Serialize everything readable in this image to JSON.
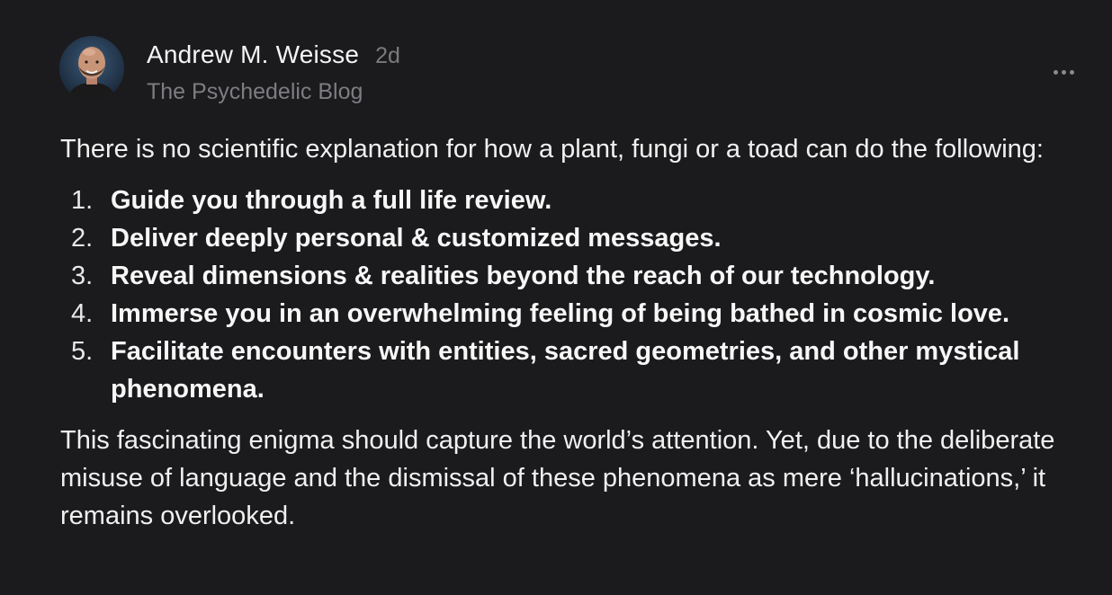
{
  "author": {
    "name": "Andrew M. Weisse",
    "timestamp": "2d",
    "publication": "The Psychedelic Blog"
  },
  "menu": {
    "icon": "more-horizontal-icon"
  },
  "post": {
    "intro": "There is no scientific explanation for how a plant, fungi or a toad can do the following:",
    "list": [
      {
        "num": "1.",
        "text": "Guide you through a full life review."
      },
      {
        "num": "2.",
        "text": "Deliver deeply personal & customized messages."
      },
      {
        "num": "3.",
        "text": "Reveal dimensions & realities beyond the reach of our technology."
      },
      {
        "num": "4.",
        "text": "Immerse you in an overwhelming feeling of being bathed in cosmic love."
      },
      {
        "num": "5.",
        "text": "Facilitate encounters with entities, sacred geometries, and other mystical phenomena."
      }
    ],
    "outro": "This fascinating enigma should capture the world’s attention. Yet, due to the deliberate misuse of language and the dismissal of these phenomena as mere ‘hallucinations,’ it remains overlooked."
  },
  "colors": {
    "background": "#1b1b1d",
    "text": "#f0f0f0",
    "muted": "#7d7d82"
  }
}
